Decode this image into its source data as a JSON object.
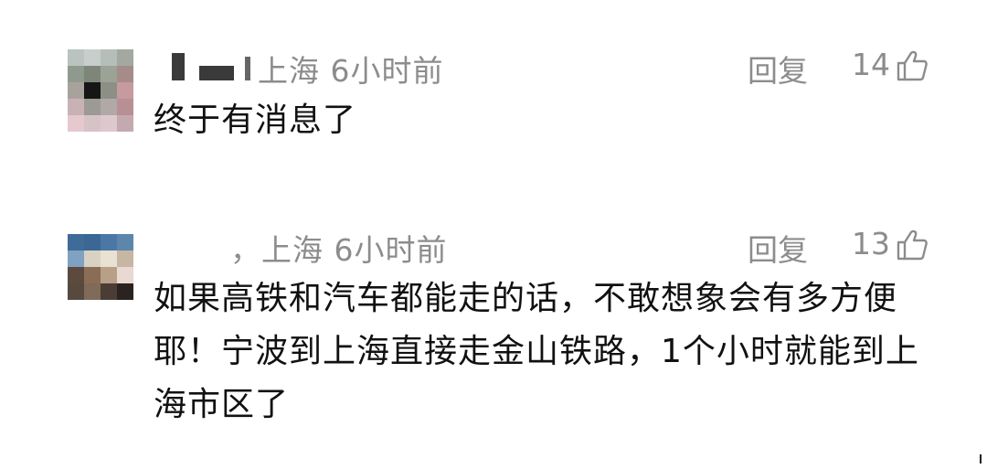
{
  "comments": [
    {
      "location_time": "上海  6小时前",
      "reply_label": "回复",
      "like_count": "14",
      "text": "终于有消息了",
      "like_icon": "thumbs-up-icon"
    },
    {
      "location_time": "，上海  6小时前",
      "reply_label": "回复",
      "like_count": "13",
      "text": "如果高铁和汽车都能走的话，不敢想象会有多方便耶！宁波到上海直接走金山铁路，1个小时就能到上海市区了",
      "like_icon": "thumbs-up-icon"
    }
  ],
  "colors": {
    "meta_gray": "#8c8c8c",
    "text_dark": "#111111"
  }
}
